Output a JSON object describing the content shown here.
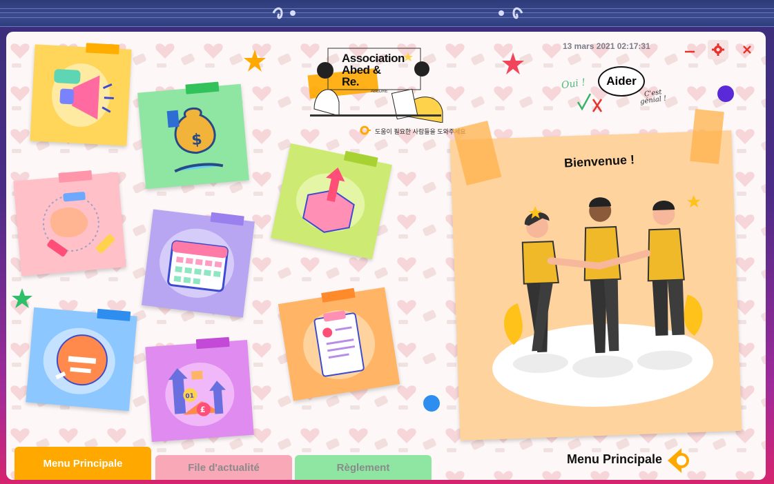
{
  "window": {
    "datetime": "13 mars 2021 02:17:31",
    "minimize_icon": "minimize-icon",
    "settings_icon": "gear-icon",
    "close_icon": "close-icon"
  },
  "logo": {
    "name": "Association Abed & Re.",
    "line1": "Association",
    "line2": "Abed &",
    "line3": "Re.",
    "tagline": "도움이 필요한 사람들을 도와주세요",
    "small_label": "ABEDRE"
  },
  "help": {
    "button_label": "Aider",
    "oui": "Oui !",
    "cest": "C'est",
    "genial": "génial !"
  },
  "welcome": {
    "title": "Bienvenue !"
  },
  "tabs": [
    {
      "label": "Menu Principale",
      "active": true
    },
    {
      "label": "File d'actualité",
      "active": false
    },
    {
      "label": "Règlement",
      "active": false
    }
  ],
  "footer": {
    "title": "Menu Principale",
    "icon": "back-arrow-icon"
  },
  "tiles": [
    {
      "icon": "megaphone-icon",
      "color": "#ffd55a"
    },
    {
      "icon": "money-bag-icon",
      "color": "#8fe6a2"
    },
    {
      "icon": "handshake-icon",
      "color": "#ffc0c8"
    },
    {
      "icon": "calendar-icon",
      "color": "#b8a6f3"
    },
    {
      "icon": "package-upload-icon",
      "color": "#cdea73"
    },
    {
      "icon": "mask-icon",
      "color": "#8cc8ff"
    },
    {
      "icon": "finance-growth-icon",
      "color": "#e08bf0"
    },
    {
      "icon": "clipboard-icon",
      "color": "#ffb466"
    }
  ],
  "colors": {
    "accent_orange": "#ffa800",
    "tab_pink": "#f9a8b8",
    "tab_green": "#8fe6a2",
    "close_red": "#e8322c"
  }
}
